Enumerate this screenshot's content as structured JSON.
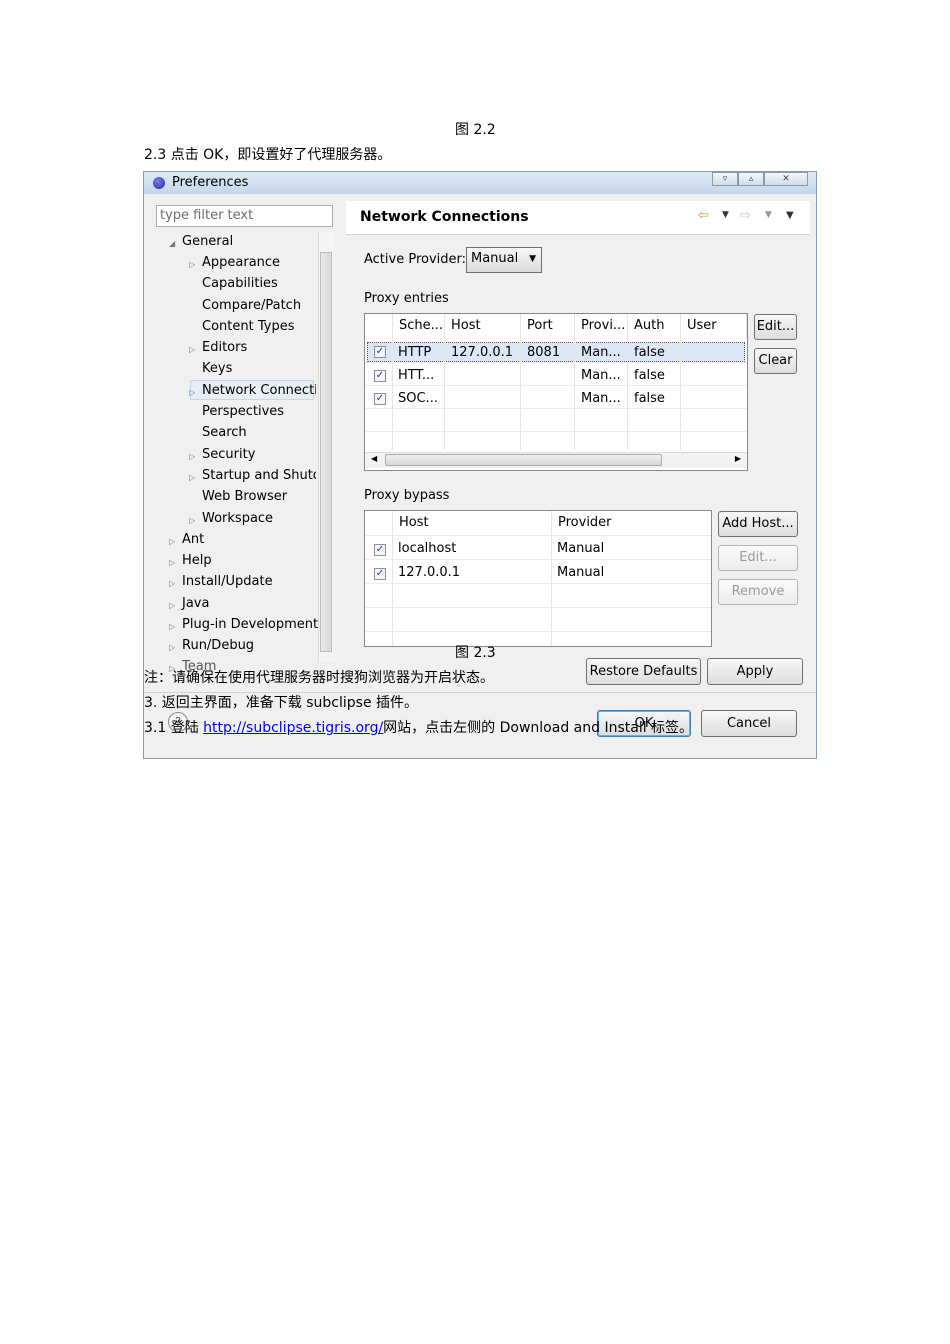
{
  "doc": {
    "caption_top": "图 2.2",
    "step_2_3": "2.3 点击 OK，即设置好了代理服务器。",
    "caption_mid": "图 2.3",
    "note": "注：请确保在使用代理服务器时搜狗浏览器为开启状态。",
    "step_3": "3.   返回主界面，准备下载 subclipse 插件。",
    "step_3_1_prefix": "3.1 登陆 ",
    "step_3_1_link": "http://subclipse.tigris.org/",
    "step_3_1_suffix": "网站，点击左侧的 Download and Install 标签。"
  },
  "window": {
    "title": "Preferences",
    "filter_placeholder": "type filter text",
    "tree": [
      {
        "label": "General",
        "expanded": true
      },
      {
        "label": "Appearance"
      },
      {
        "label": "Capabilities"
      },
      {
        "label": "Compare/Patch"
      },
      {
        "label": "Content Types"
      },
      {
        "label": "Editors"
      },
      {
        "label": "Keys"
      },
      {
        "label": "Network Connecti"
      },
      {
        "label": "Perspectives"
      },
      {
        "label": "Search"
      },
      {
        "label": "Security"
      },
      {
        "label": "Startup and Shutd"
      },
      {
        "label": "Web Browser"
      },
      {
        "label": "Workspace"
      },
      {
        "label": "Ant"
      },
      {
        "label": "Help"
      },
      {
        "label": "Install/Update"
      },
      {
        "label": "Java"
      },
      {
        "label": "Plug-in Development"
      },
      {
        "label": "Run/Debug"
      },
      {
        "label": "Team"
      }
    ],
    "panel_title": "Network Connections",
    "active_provider_label": "Active Provider:",
    "active_provider_value": "Manual",
    "proxy_entries_label": "Proxy entries",
    "entries_columns": [
      "Sche...",
      "Host",
      "Port",
      "Provi...",
      "Auth",
      "User"
    ],
    "entries_rows": [
      {
        "checked": true,
        "scheme": "HTTP",
        "host": "127.0.0.1",
        "port": "8081",
        "provider": "Man...",
        "auth": "false",
        "user": ""
      },
      {
        "checked": true,
        "scheme": "HTT...",
        "host": "",
        "port": "",
        "provider": "Man...",
        "auth": "false",
        "user": ""
      },
      {
        "checked": true,
        "scheme": "SOC...",
        "host": "",
        "port": "",
        "provider": "Man...",
        "auth": "false",
        "user": ""
      }
    ],
    "edit_button": "Edit...",
    "clear_button": "Clear",
    "proxy_bypass_label": "Proxy bypass",
    "bypass_columns": [
      "Host",
      "Provider"
    ],
    "bypass_rows": [
      {
        "checked": true,
        "host": "localhost",
        "provider": "Manual"
      },
      {
        "checked": true,
        "host": "127.0.0.1",
        "provider": "Manual"
      }
    ],
    "add_host_button": "Add Host...",
    "bypass_edit_button": "Edit...",
    "remove_button": "Remove",
    "restore_defaults_button": "Restore Defaults",
    "apply_button": "Apply",
    "ok_button": "OK",
    "cancel_button": "Cancel"
  }
}
